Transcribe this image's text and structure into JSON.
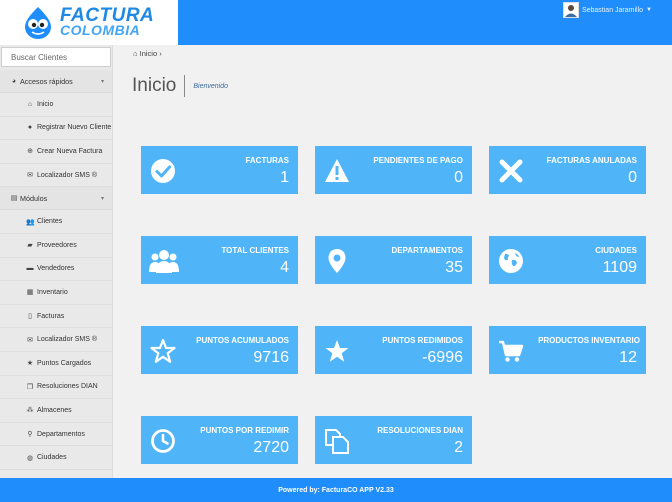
{
  "header": {
    "brand_line1": "FACTURA",
    "brand_line2": "COLOMBIA",
    "user_name": "Sebastian Jaramillo",
    "brand_color": "#1f8dfc"
  },
  "sidebar": {
    "search_placeholder": "Buscar Clientes",
    "quick_section": "Accesos rápidos",
    "quick_items": [
      {
        "label": "Inicio",
        "icon": "home-icon"
      },
      {
        "label": "Registrar Nuevo Cliente",
        "icon": "user-icon"
      },
      {
        "label": "Crear Nueva Factura",
        "icon": "plus-circle-icon"
      },
      {
        "label": "Localizador SMS ®",
        "icon": "envelope-icon"
      }
    ],
    "modules_section": "Módulos",
    "module_items": [
      {
        "label": "Clientes",
        "icon": "users-icon"
      },
      {
        "label": "Proveedores",
        "icon": "truck-icon"
      },
      {
        "label": "Vendedores",
        "icon": "briefcase-icon"
      },
      {
        "label": "Inventario",
        "icon": "grid-icon"
      },
      {
        "label": "Facturas",
        "icon": "document-icon"
      },
      {
        "label": "Localizador SMS ®",
        "icon": "envelope-icon"
      },
      {
        "label": "Puntos Cargados",
        "icon": "star-icon"
      },
      {
        "label": "Resoluciones DIAN",
        "icon": "copy-icon"
      },
      {
        "label": "Almacenes",
        "icon": "sitemap-icon"
      },
      {
        "label": "Departamentos",
        "icon": "map-pin-icon"
      },
      {
        "label": "Ciudades",
        "icon": "globe-icon"
      }
    ]
  },
  "breadcrumb": {
    "home": "Inicio"
  },
  "page": {
    "title": "Inicio",
    "subtitle": "Bienvenido"
  },
  "cards": [
    {
      "label": "FACTURAS",
      "value": "1",
      "icon": "check-circle-icon"
    },
    {
      "label": "PENDIENTES DE PAGO",
      "value": "0",
      "icon": "warning-icon"
    },
    {
      "label": "FACTURAS ANULADAS",
      "value": "0",
      "icon": "x-icon"
    },
    {
      "label": "TOTAL CLIENTES",
      "value": "4",
      "icon": "users-icon"
    },
    {
      "label": "DEPARTAMENTOS",
      "value": "35",
      "icon": "map-pin-icon"
    },
    {
      "label": "CIUDADES",
      "value": "1109",
      "icon": "globe-icon"
    },
    {
      "label": "PUNTOS ACUMULADOS",
      "value": "9716",
      "icon": "star-outline-icon"
    },
    {
      "label": "PUNTOS REDIMIDOS",
      "value": "-6996",
      "icon": "star-icon"
    },
    {
      "label": "PRODUCTOS INVENTARIO",
      "value": "12",
      "icon": "cart-icon"
    },
    {
      "label": "PUNTOS POR REDIMIR",
      "value": "2720",
      "icon": "clock-icon"
    },
    {
      "label": "RESOLUCIONES DIAN",
      "value": "2",
      "icon": "copy-icon"
    }
  ],
  "footer": {
    "text": "Powered by: FacturaCO APP V2.33"
  }
}
